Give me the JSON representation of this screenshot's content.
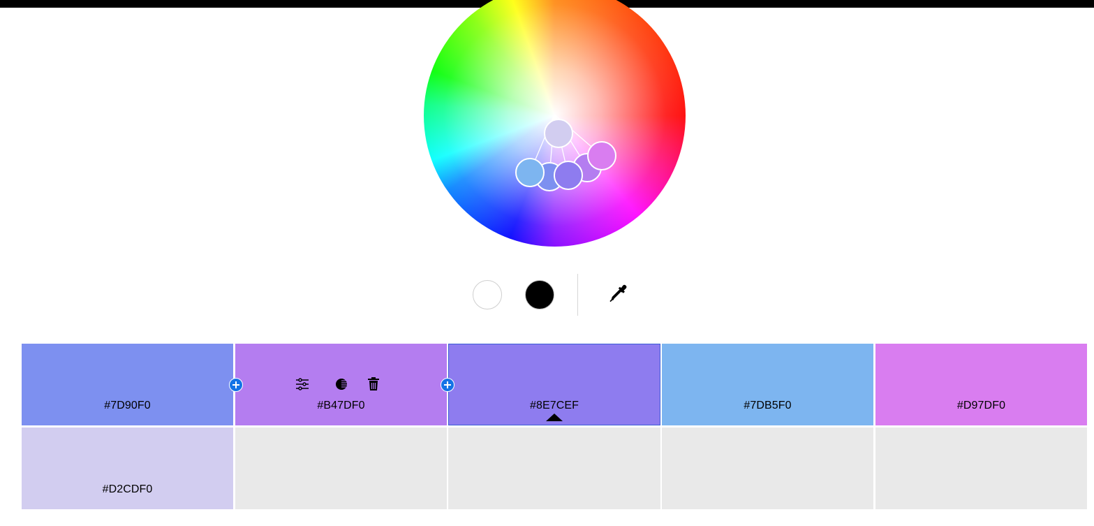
{
  "colors": {
    "swatches": [
      "#7D90F0",
      "#B47DF0",
      "#8E7CEF",
      "#7DB5F0",
      "#D97DF0"
    ],
    "shade": "#D2CDF0",
    "empty": "#E9E9E9",
    "accent": "#1473E6"
  },
  "swatches": [
    {
      "hex": "#7D90F0"
    },
    {
      "hex": "#B47DF0"
    },
    {
      "hex": "#8E7CEF"
    },
    {
      "hex": "#7DB5F0"
    },
    {
      "hex": "#D97DF0"
    }
  ],
  "shades": [
    {
      "hex": "#D2CDF0"
    }
  ],
  "tools": {
    "white_icon": "white-swatch-icon",
    "black_icon": "black-swatch-icon",
    "picker_icon": "eyedropper-icon"
  },
  "swatch_actions": [
    "sliders-icon",
    "contrast-icon",
    "trash-icon"
  ],
  "selected_swatch_index": 2
}
